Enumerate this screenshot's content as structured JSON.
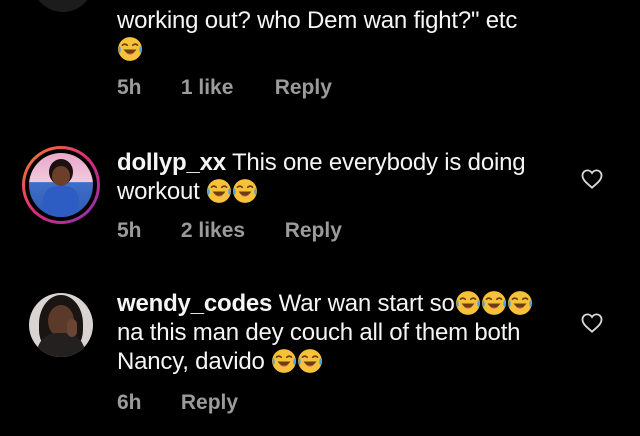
{
  "comments": [
    {
      "username": "",
      "text_line1": "working out? who Dem wan fight?\" etc",
      "time": "5h",
      "likes": "1 like",
      "reply": "Reply"
    },
    {
      "username": "dollyp_xx",
      "text": "This one everybody is doing workout",
      "time": "5h",
      "likes": "2 likes",
      "reply": "Reply"
    },
    {
      "username": "wendy_codes",
      "text_line1": "War wan start so",
      "text_line2": "na this man dey couch all of them both",
      "text_line3": "Nancy, davido",
      "time": "6h",
      "reply": "Reply"
    }
  ],
  "icons": {
    "emoji": "face-with-tears-of-joy",
    "like": "heart-outline"
  },
  "colors": {
    "background": "#000000",
    "text": "#f5f5f5",
    "meta": "#9b9b9b",
    "story_ring": "#e1306c"
  }
}
